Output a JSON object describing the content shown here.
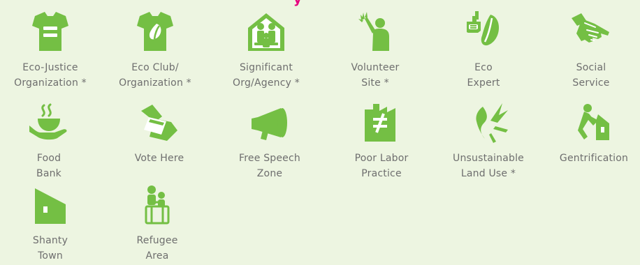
{
  "heading_fragment": "y",
  "colors": {
    "accent_green": "#74bf44",
    "heading_pink": "#e6007e",
    "background": "#edf5e1",
    "text": "#6e6e6e"
  },
  "items": [
    {
      "icon": "shirt-equals-icon",
      "label": "Eco-Justice\nOrganization *"
    },
    {
      "icon": "shirt-leaf-icon",
      "label": "Eco Club/\nOrganization *"
    },
    {
      "icon": "house-people-icon",
      "label": "Significant\nOrg/Agency *"
    },
    {
      "icon": "volunteer-hand-icon",
      "label": "Volunteer\nSite *"
    },
    {
      "icon": "hand-leaf-icon",
      "label": "Eco\nExpert"
    },
    {
      "icon": "helping-hand-icon",
      "label": "Social\nService"
    },
    {
      "icon": "food-bowl-hand-icon",
      "label": "Food\nBank"
    },
    {
      "icon": "ballot-hand-icon",
      "label": "Vote Here"
    },
    {
      "icon": "megaphone-icon",
      "label": "Free Speech\nZone"
    },
    {
      "icon": "factory-not-equal-icon",
      "label": "Poor Labor\nPractice"
    },
    {
      "icon": "broken-land-icon",
      "label": "Unsustainable\nLand Use *"
    },
    {
      "icon": "pushed-house-icon",
      "label": "Gentrification"
    },
    {
      "icon": "shanty-house-icon",
      "label": "Shanty\nTown"
    },
    {
      "icon": "refugee-family-icon",
      "label": "Refugee\nArea"
    }
  ]
}
